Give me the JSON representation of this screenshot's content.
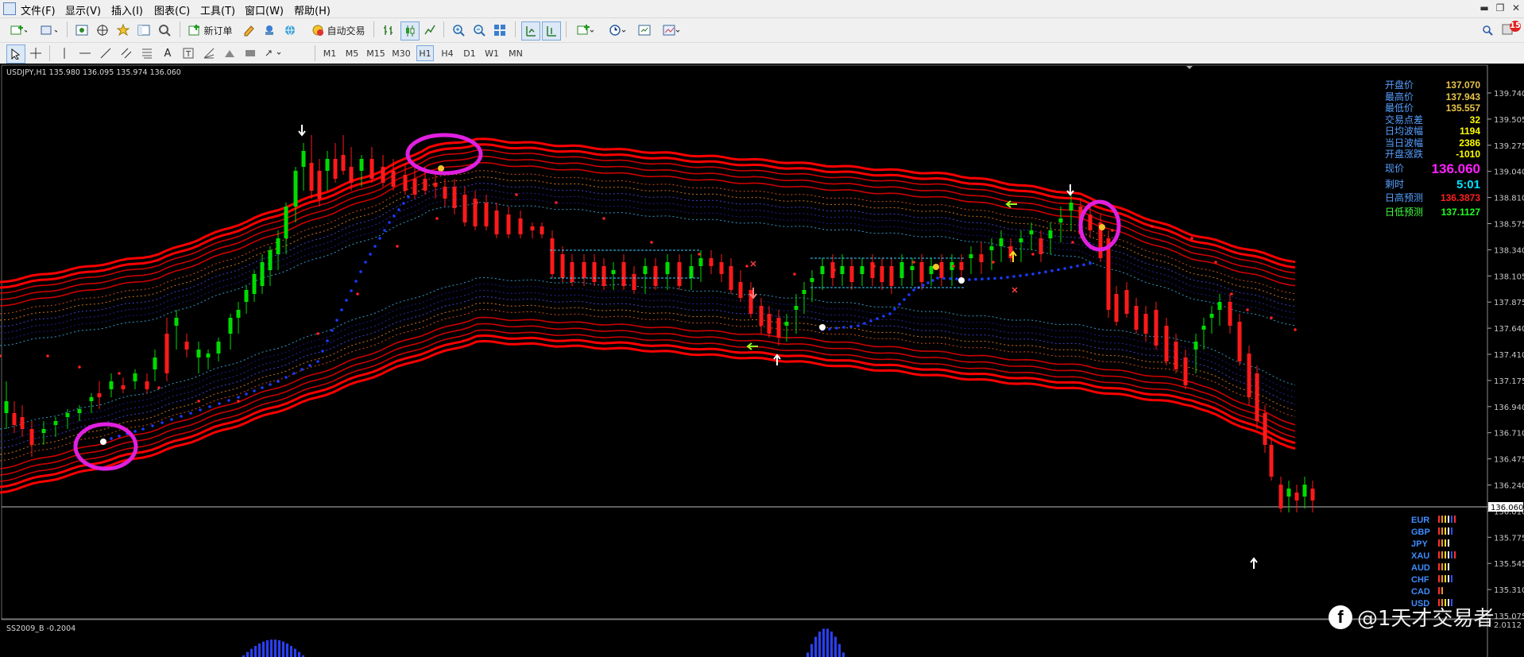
{
  "menu": {
    "items": [
      "文件(F)",
      "显示(V)",
      "插入(I)",
      "图表(C)",
      "工具(T)",
      "窗口(W)",
      "帮助(H)"
    ],
    "window_controls": [
      "minimize-icon",
      "restore-icon",
      "close-icon"
    ]
  },
  "toolbar1": {
    "new_order_label": "新订单",
    "auto_trade_label": "自动交易",
    "alert_badge": "15"
  },
  "toolbar2": {
    "timeframes": [
      "M1",
      "M5",
      "M15",
      "M30",
      "H1",
      "H4",
      "D1",
      "W1",
      "MN"
    ],
    "active_timeframe": "H1"
  },
  "chart": {
    "symbol_label": "USDJPY,H1  135.980 136.095 135.974 136.060",
    "current_price_tag": "136.060",
    "price_ticks": [
      "139.740",
      "139.505",
      "139.275",
      "139.040",
      "138.810",
      "138.575",
      "138.340",
      "138.105",
      "137.875",
      "137.640",
      "137.410",
      "137.175",
      "136.940",
      "136.710",
      "136.475",
      "136.240",
      "136.010",
      "135.775",
      "135.545",
      "135.310",
      "135.075"
    ],
    "indicator_label": "SS2009_B -0.2004",
    "indicator_value": "2.0112",
    "colors": {
      "bull_candle": "#00dd00",
      "bear_candle": "#ff1a1a",
      "band": "#ff0000",
      "highlight_circle": "#e020e0",
      "blue_dots": "#1a3cff"
    }
  },
  "info_panel": {
    "rows": [
      {
        "label": "开盘价",
        "value": "137.070",
        "color": "#e8c44a"
      },
      {
        "label": "最高价",
        "value": "137.943",
        "color": "#e8c44a"
      },
      {
        "label": "最低价",
        "value": "135.557",
        "color": "#e8c44a"
      },
      {
        "label": "交易点差",
        "value": "32",
        "color": "#ffff00"
      },
      {
        "label": "日均波幅",
        "value": "1194",
        "color": "#ffff00"
      },
      {
        "label": "当日波幅",
        "value": "2386",
        "color": "#ffff00"
      },
      {
        "label": "开盘涨跌",
        "value": "-1010",
        "color": "#ffff00"
      }
    ],
    "current_label": "现价",
    "current_value": "136.060",
    "time_label": "剩时",
    "time_value": "5:01",
    "high_forecast_label": "日高预测",
    "high_forecast_value": "136.3873",
    "low_forecast_label": "日低预测",
    "low_forecast_value": "137.1127"
  },
  "currency_strength": [
    "EUR",
    "GBP",
    "JPY",
    "XAU",
    "AUD",
    "CHF",
    "CAD",
    "USD"
  ],
  "watermark": "@1天才交易者"
}
